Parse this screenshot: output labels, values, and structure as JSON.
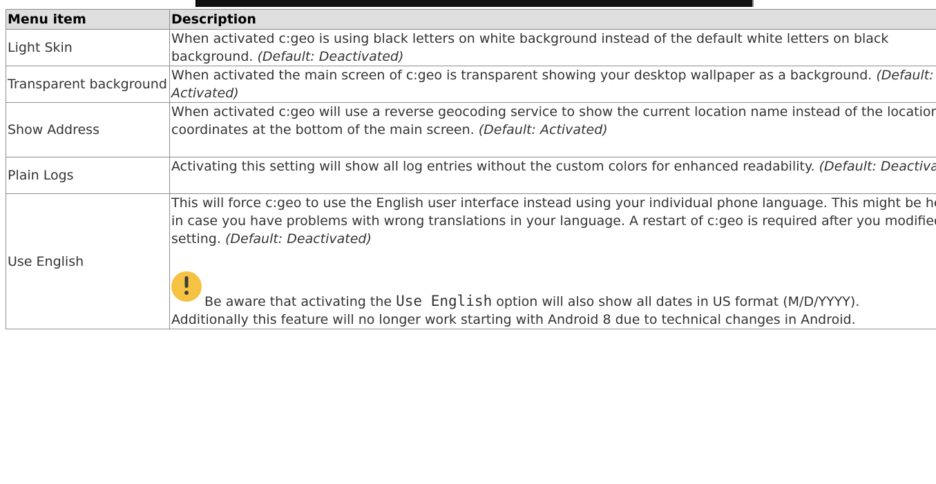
{
  "table": {
    "headers": {
      "menu_item": "Menu item",
      "description": "Description"
    },
    "rows": [
      {
        "item": "Light Skin",
        "text": "When activated c:geo is using black letters on white background instead of the default white letters on black background.",
        "default": "(Default: Deactivated)"
      },
      {
        "item": "Transparent background",
        "text": "When activated the main screen of c:geo is transparent showing your desktop wallpaper as a background.",
        "default": "(Default: Activated)"
      },
      {
        "item": "Show Address",
        "text": "When activated c:geo will use a reverse geocoding service to show the current location name instead of the location coordinates at the bottom of the main screen.",
        "default": "(Default: Activated)"
      },
      {
        "item": "Plain Logs",
        "text": "Activating this setting will show all log entries without the custom colors for enhanced readability.",
        "default": "(Default: Deactivated)"
      },
      {
        "item": "Use English",
        "text": "This will force c:geo to use the English user interface instead using your individual phone language. This might be helpful in case you have problems with wrong translations in your language. A restart of c:geo is required after you modified this setting.",
        "default": "(Default: Deactivated)",
        "warning_before": "Be aware that activating the",
        "warning_code": "Use English",
        "warning_after": "option will also show all dates in US format (M/D/YYYY).",
        "extra_note": "Additionally this feature will no longer work starting with Android 8 due to technical changes in Android."
      }
    ]
  },
  "icons": {
    "warning": "warning-icon",
    "warning_color": "#f5c242"
  }
}
